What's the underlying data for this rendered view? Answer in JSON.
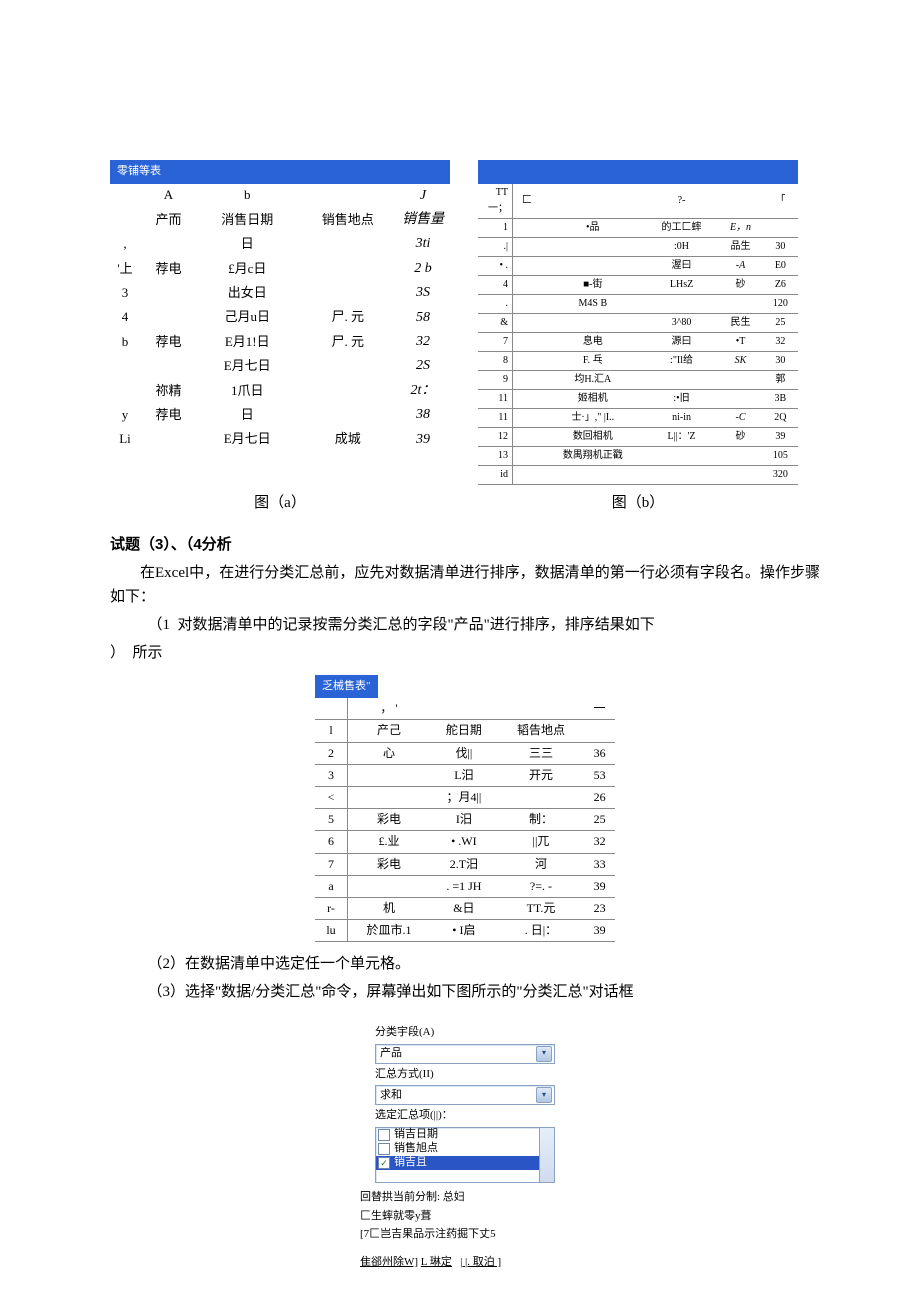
{
  "tableA": {
    "title": "零铺等表",
    "colHeaders": [
      "",
      "A",
      "b",
      "",
      "J"
    ],
    "fieldHeaders": [
      "",
      "产而",
      "消售日期",
      "销售地点",
      "销售量"
    ],
    "rows": [
      {
        "n": ",",
        "c1": "",
        "c2": "日",
        "c3": "",
        "val": "3ti"
      },
      {
        "n": "'上",
        "c1": "荐电",
        "c2": "£月c日",
        "c3": "",
        "val": "2 b"
      },
      {
        "n": "3",
        "c1": "",
        "c2": "出女日",
        "c3": "",
        "val": "3S"
      },
      {
        "n": "4",
        "c1": "",
        "c2": "己月u日",
        "c3": "尸. 元",
        "val": "58"
      },
      {
        "n": "b",
        "c1": "荐电",
        "c2": "E月1!日",
        "c3": "尸. 元",
        "val": "32"
      },
      {
        "n": "",
        "c1": "",
        "c2": "E月七日",
        "c3": "",
        "val": "2S"
      },
      {
        "n": "",
        "c1": "祢精",
        "c2": "1爪日",
        "c3": "",
        "val": "2t："
      },
      {
        "n": "y",
        "c1": "荐电",
        "c2": "日",
        "c3": "",
        "val": "38"
      },
      {
        "n": "Li",
        "c1": "",
        "c2": "E月七日",
        "c3": "成城",
        "val": "39"
      }
    ]
  },
  "tableB": {
    "header": [
      "TT 一；",
      "匚",
      "",
      "?-",
      "",
      "「"
    ],
    "rows": [
      {
        "n": "1",
        "a": "•品",
        "b": "的工匚蟀",
        "c": "E，n",
        "d": ""
      },
      {
        "n": ".|",
        "a": "",
        "b": ":0H",
        "c": "品生",
        "d": "30"
      },
      {
        "n": "• .",
        "a": "",
        "b": "渥曰",
        "c": "-A",
        "d": "E0"
      },
      {
        "n": "4",
        "a": "■-街",
        "b": "LHsZ",
        "c": "砂",
        "d": "Z6"
      },
      {
        "n": ".",
        "a": "M4S B",
        "b": "",
        "c": "",
        "d": "120"
      },
      {
        "n": "&",
        "a": "",
        "b": "3^80",
        "c": "民生",
        "d": "25"
      },
      {
        "n": "7",
        "a": "息电",
        "b": "源曰",
        "c": "•T",
        "d": "32"
      },
      {
        "n": "8",
        "a": "F. 乓",
        "b": ":\"Il给",
        "c": "SK",
        "d": "30"
      },
      {
        "n": "9",
        "a": "均H.汇A",
        "b": "",
        "c": "",
        "d": "郭"
      },
      {
        "n": "11",
        "a": "姬相机",
        "b": ":•旧",
        "c": "",
        "d": "3B"
      },
      {
        "n": "11",
        "a": "士·」,\" |I..",
        "b": "ni-in",
        "c": "-C",
        "d": "2Q"
      },
      {
        "n": "12",
        "a": "数回相机",
        "b": "L||：'Z",
        "c": "砂",
        "d": "39"
      },
      {
        "n": "13",
        "a": "数禺翔机正戳",
        "b": "",
        "c": "",
        "d": "105"
      },
      {
        "n": "id",
        "a": "",
        "b": "",
        "c": "",
        "d": "320"
      }
    ]
  },
  "captions": {
    "a": "图（a）",
    "b": "图（b）"
  },
  "heading": "试题（3）、（4分析",
  "para1": "在Excel中，在进行分类汇总前，应先对数据清单进行排序，数据清单的第一行必须有字段名。操作步骤如下：",
  "step1_a": "（1",
  "step1_b": "对数据清单中的记录按需分类汇总的字段\"产品\"进行排序，排序结果如下",
  "step1_c": "）",
  "step1_d": "所示",
  "tableC": {
    "title": "乏械售表\"",
    "subhead": [
      "",
      "，  '",
      "",
      "",
      "一"
    ],
    "rows": [
      {
        "n": "l",
        "a": "产己",
        "b": "舵日期",
        "c": "韬告地点",
        "d": ""
      },
      {
        "n": "2",
        "a": "心",
        "b": "伐||",
        "c": "三三",
        "d": "36"
      },
      {
        "n": "3",
        "a": "",
        "b": "L汨",
        "c": "开元",
        "d": "53"
      },
      {
        "n": "<",
        "a": "",
        "b": "；月4||",
        "c": "",
        "d": "26"
      },
      {
        "n": "5",
        "a": "彩电",
        "b": "I汨",
        "c": "制：",
        "d": "25"
      },
      {
        "n": "6",
        "a": "£.业",
        "b": "• .WI",
        "c": "||兀",
        "d": "32"
      },
      {
        "n": "7",
        "a": "彩电",
        "b": "2.T汨",
        "c": "河",
        "d": "33"
      },
      {
        "n": "a",
        "a": "",
        "b": ". =1 JH",
        "c": "?=. -",
        "d": "39"
      },
      {
        "n": "r-",
        "a": "机",
        "b": "&日",
        "c": "TT.元",
        "d": "23"
      },
      {
        "n": "lu",
        "a": "於皿市.1",
        "b": "• I启",
        "c": ". 日|：",
        "d": "39"
      }
    ]
  },
  "step2": "（2）在数据清单中选定任一个单元格。",
  "step3": "（3）选择\"数据/分类汇总\"命令，屏幕弹出如下图所示的\"分类汇总\"对话框",
  "dialog": {
    "lbl_field": "分类宇段(A)",
    "val_field": "产品",
    "lbl_method": "汇总方式(II)",
    "val_method": "求和",
    "lbl_items": "选定汇总项(||)：",
    "items": [
      {
        "checked": false,
        "label": "销吉日期"
      },
      {
        "checked": false,
        "label": "销售旭点"
      },
      {
        "checked": true,
        "label": "销吉且",
        "selected": true
      }
    ],
    "footers": [
      "回替拱当前分制: 总妇",
      "匚生蟀就零y葺",
      "[7匚岂吉果品示注药掘下丈5"
    ],
    "buttons_line": "隹郤州除W]",
    "btn_ok": "L 琳定",
    "btn_cancel": "| |. 取泊 ]"
  }
}
